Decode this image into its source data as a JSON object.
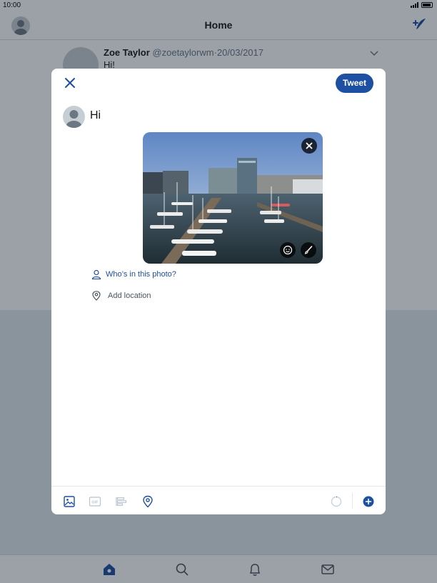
{
  "status_bar": {
    "time": "10:00"
  },
  "nav": {
    "title": "Home"
  },
  "background_tweet": {
    "author_name": "Zoe Taylor",
    "author_handle": "@zoetaylorwm",
    "separator": "·",
    "date": "20/03/2017",
    "text": "Hi!"
  },
  "composer": {
    "close_label": "close",
    "tweet_button": "Tweet",
    "text": "Hi",
    "tag_people": "Who’s in this photo?",
    "add_location": "Add location"
  },
  "toolbar": {
    "icons": [
      "image-icon",
      "gif-icon",
      "poll-icon",
      "location-icon",
      "character-counter-icon",
      "add-tweet-icon"
    ],
    "character_count_progress": 0.01
  },
  "tab_bar": {
    "icons": [
      "home-icon",
      "search-icon",
      "notifications-icon",
      "messages-icon"
    ],
    "selected": "home-icon"
  },
  "colors": {
    "accent": "#1d4fa3",
    "overlay": "rgba(20,30,45,0.42)",
    "icon_muted": "#b8c4cf"
  }
}
